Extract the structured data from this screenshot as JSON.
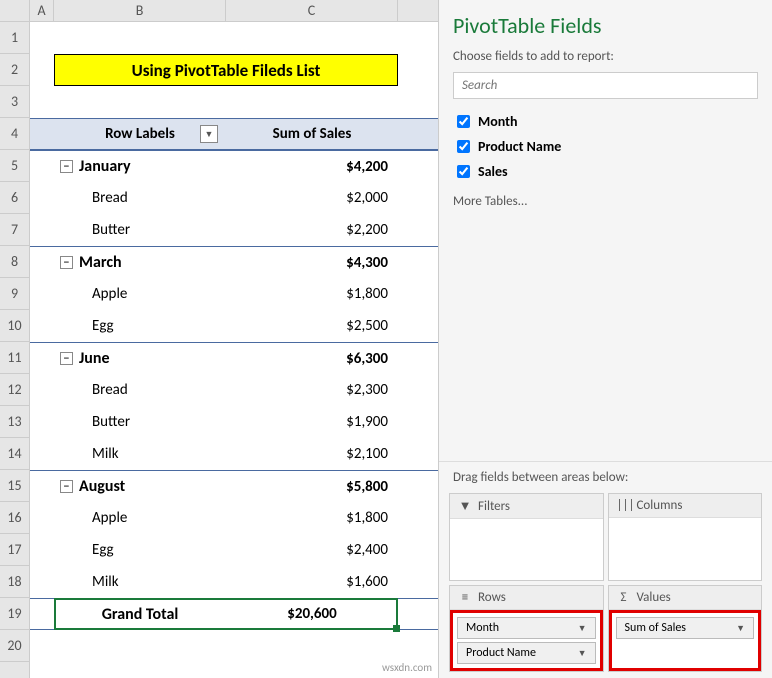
{
  "columns": [
    "A",
    "B",
    "C"
  ],
  "row_numbers": [
    "1",
    "2",
    "3",
    "4",
    "5",
    "6",
    "7",
    "8",
    "9",
    "10",
    "11",
    "12",
    "13",
    "14",
    "15",
    "16",
    "17",
    "18",
    "19",
    "20"
  ],
  "title": "Using PivotTable Fileds List",
  "pivot_header": {
    "row_labels": "Row Labels",
    "sum_col": "Sum of Sales"
  },
  "pivot": [
    {
      "type": "month",
      "label": "January",
      "value": "$4,200",
      "items": [
        {
          "label": "Bread",
          "value": "$2,000"
        },
        {
          "label": "Butter",
          "value": "$2,200"
        }
      ]
    },
    {
      "type": "month",
      "label": "March",
      "value": "$4,300",
      "items": [
        {
          "label": "Apple",
          "value": "$1,800"
        },
        {
          "label": "Egg",
          "value": "$2,500"
        }
      ]
    },
    {
      "type": "month",
      "label": "June",
      "value": "$6,300",
      "items": [
        {
          "label": "Bread",
          "value": "$2,300"
        },
        {
          "label": "Butter",
          "value": "$1,900"
        },
        {
          "label": "Milk",
          "value": "$2,100"
        }
      ]
    },
    {
      "type": "month",
      "label": "August",
      "value": "$5,800",
      "items": [
        {
          "label": "Apple",
          "value": "$1,800"
        },
        {
          "label": "Egg",
          "value": "$2,400"
        },
        {
          "label": "Milk",
          "value": "$1,600"
        }
      ]
    }
  ],
  "grand": {
    "label": "Grand Total",
    "value": "$20,600"
  },
  "pane": {
    "title": "PivotTable Fields",
    "subtitle": "Choose fields to add to report:",
    "search_ph": "Search",
    "fields": [
      "Month",
      "Product Name",
      "Sales"
    ],
    "more": "More Tables...",
    "drag": "Drag fields between areas below:",
    "areas": {
      "filters": "Filters",
      "columns": "Columns",
      "rows": "Rows",
      "values": "Values"
    },
    "rows_chips": [
      "Month",
      "Product Name"
    ],
    "values_chips": [
      "Sum of Sales"
    ]
  },
  "watermark": "wsxdn.com",
  "icons": {
    "filter": "▼",
    "cols": "|||",
    "rows": "≡",
    "sigma": "Σ",
    "collapse": "−",
    "dd": "▼"
  }
}
